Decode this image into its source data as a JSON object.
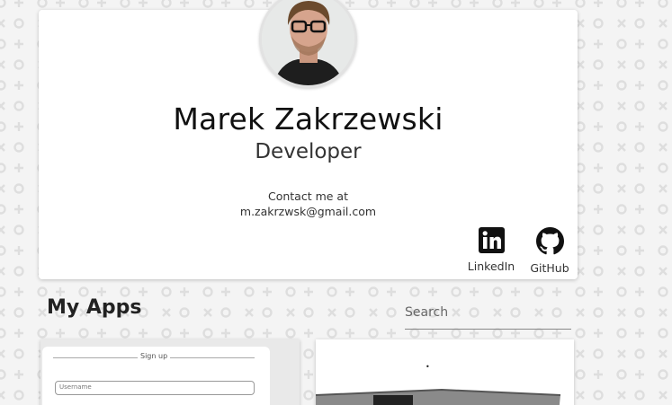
{
  "profile": {
    "name": "Marek Zakrzewski",
    "role": "Developer",
    "contact_label": "Contact me at",
    "email": "m.zakrzwsk@gmail.com"
  },
  "social": {
    "linkedin_label": "LinkedIn",
    "linkedin_icon": "linkedin-icon",
    "github_label": "GitHub",
    "github_icon": "github-icon"
  },
  "apps": {
    "title": "My Apps",
    "search_placeholder": "Search",
    "search_value": "",
    "cards": [
      {
        "preview_heading": "Sign up",
        "preview_input_placeholder": "Username"
      },
      {
        "preview_mark": "•"
      }
    ]
  },
  "colors": {
    "background": "#f4f4f4",
    "pattern": "#dcdcdc",
    "card": "#ffffff",
    "text": "#111111"
  }
}
